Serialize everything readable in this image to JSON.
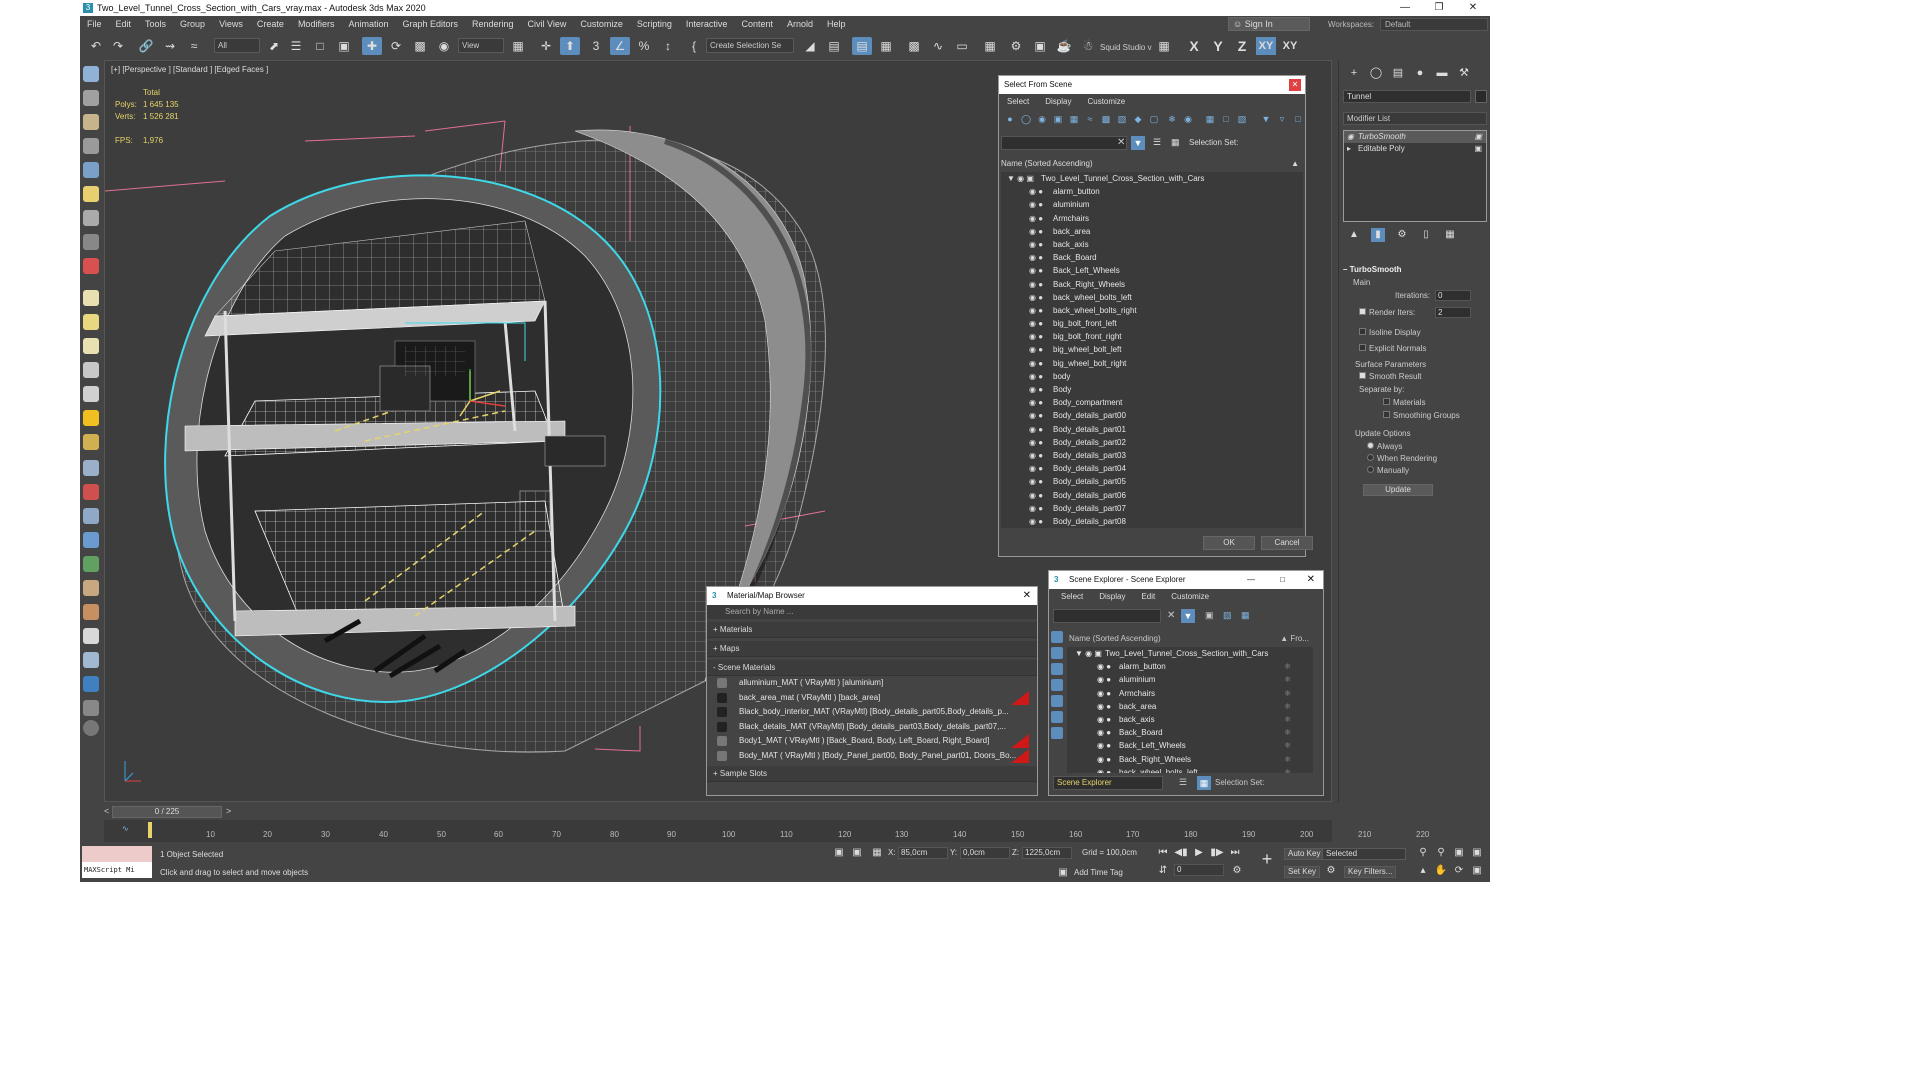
{
  "titlebar": {
    "title": "Two_Level_Tunnel_Cross_Section_with_Cars_vray.max - Autodesk 3ds Max 2020",
    "app_icon": "3"
  },
  "menu": [
    "File",
    "Edit",
    "Tools",
    "Group",
    "Views",
    "Create",
    "Modifiers",
    "Animation",
    "Graph Editors",
    "Rendering",
    "Civil View",
    "Customize",
    "Scripting",
    "Interactive",
    "Content",
    "Arnold",
    "Help"
  ],
  "account": {
    "signin": "Sign In",
    "workspace_label": "Workspaces:",
    "workspace_value": "Default"
  },
  "toolbar": {
    "filter_value": "All",
    "refcoord_value": "View",
    "named_selection": "Create Selection Se",
    "squid_label": "Squid Studio v",
    "axis": [
      "X",
      "Y",
      "Z",
      "XY",
      "XY"
    ]
  },
  "viewport": {
    "label": "[+] [Perspective ] [Standard ] [Edged Faces ]",
    "stats": {
      "total_label": "Total",
      "polys_label": "Polys:",
      "polys_value": "1 645 135",
      "verts_label": "Verts:",
      "verts_value": "1 526 281",
      "fps_label": "FPS:",
      "fps_value": "1,976"
    }
  },
  "select_from_scene": {
    "title": "Select From Scene",
    "menu": [
      "Select",
      "Display",
      "Customize"
    ],
    "selection_set_label": "Selection Set:",
    "column": "Name (Sorted Ascending)",
    "root": "Two_Level_Tunnel_Cross_Section_with_Cars",
    "items": [
      "alarm_button",
      "aluminium",
      "Armchairs",
      "back_area",
      "back_axis",
      "Back_Board",
      "Back_Left_Wheels",
      "Back_Right_Wheels",
      "back_wheel_bolts_left",
      "back_wheel_bolts_right",
      "big_bolt_front_left",
      "big_bolt_front_right",
      "big_wheel_bolt_left",
      "big_wheel_bolt_right",
      "body",
      "Body",
      "Body_compartment",
      "Body_details_part00",
      "Body_details_part01",
      "Body_details_part02",
      "Body_details_part03",
      "Body_details_part04",
      "Body_details_part05",
      "Body_details_part06",
      "Body_details_part07",
      "Body_details_part08"
    ],
    "ok": "OK",
    "cancel": "Cancel"
  },
  "material_browser": {
    "title": "Material/Map Browser",
    "search_placeholder": "Search by Name ...",
    "sections": [
      "+ Materials",
      "+ Maps",
      "- Scene Materials"
    ],
    "materials": [
      "alluminium_MAT  ( VRayMtl )  [aluminium]",
      "back_area_mat  ( VRayMtl )  [back_area]",
      "Black_body_interior_MAT (VRayMtl) [Body_details_part05,Body_details_p...",
      "Black_details_MAT (VRayMtl) [Body_details_part03,Body_details_part07,...",
      "Body1_MAT  ( VRayMtl )  [Back_Board, Body, Left_Board, Right_Board]",
      "Body_MAT  ( VRayMtl )  [Body_Panel_part00, Body_Panel_part01, Doors_Bo..."
    ],
    "sample_slots": "+ Sample Slots"
  },
  "scene_explorer": {
    "title": "Scene Explorer - Scene Explorer",
    "menu": [
      "Select",
      "Display",
      "Edit",
      "Customize"
    ],
    "column": "Name (Sorted Ascending)",
    "frozen_column": "▲ Fro...",
    "root": "Two_Level_Tunnel_Cross_Section_with_Cars",
    "items": [
      "alarm_button",
      "aluminium",
      "Armchairs",
      "back_area",
      "back_axis",
      "Back_Board",
      "Back_Left_Wheels",
      "Back_Right_Wheels",
      "back_wheel_bolts_left"
    ],
    "tab_name": "Scene Explorer",
    "selection_set_label": "Selection Set:"
  },
  "command_panel": {
    "object_name": "Tunnel",
    "modifier_list": "Modifier List",
    "stack": [
      "TurboSmooth",
      "Editable Poly"
    ],
    "rollout": {
      "title": "TurboSmooth",
      "main": "Main",
      "iterations_label": "Iterations:",
      "iterations_value": "0",
      "render_iters_label": "Render Iters:",
      "render_iters_value": "2",
      "isoline": "Isoline Display",
      "explicit": "Explicit Normals",
      "surface_params": "Surface Parameters",
      "smooth_result": "Smooth Result",
      "separate_by": "Separate by:",
      "materials": "Materials",
      "smoothing_groups": "Smoothing Groups",
      "update_options": "Update Options",
      "always": "Always",
      "when_rendering": "When Rendering",
      "manually": "Manually",
      "update_button": "Update"
    }
  },
  "timeline": {
    "frame_display": "0 / 225",
    "ticks": [
      "10",
      "20",
      "30",
      "40",
      "50",
      "60",
      "70",
      "80",
      "90",
      "100",
      "110",
      "120",
      "130",
      "140",
      "150",
      "160",
      "170",
      "180",
      "190",
      "200",
      "210",
      "220"
    ]
  },
  "statusbar": {
    "maxscript": "MAXScript Mi",
    "selected": "1 Object Selected",
    "hint": "Click and drag to select and move objects",
    "x_label": "X:",
    "x_value": "85,0cm",
    "y_label": "Y:",
    "y_value": "0,0cm",
    "z_label": "Z:",
    "z_value": "1225,0cm",
    "grid": "Grid = 100,0cm",
    "add_time_tag": "Add Time Tag",
    "auto_key": "Auto Key",
    "set_key": "Set Key",
    "selected_drop": "Selected",
    "key_filters": "Key Filters...",
    "frame_value": "0"
  }
}
